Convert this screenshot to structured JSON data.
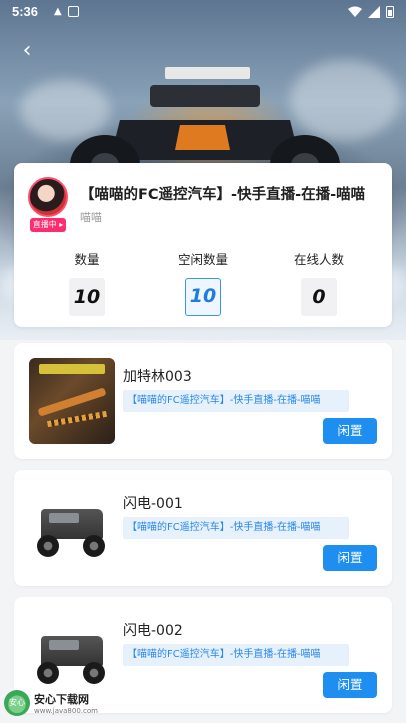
{
  "status_bar": {
    "time": "5:36"
  },
  "live_room": {
    "title": "【喵喵的FC遥控汽车】-快手直播-在播-喵喵",
    "host": "喵喵",
    "live_badge": "直播中 ▸"
  },
  "stats": [
    {
      "label": "数量",
      "value": "10",
      "active": false
    },
    {
      "label": "空闲数量",
      "value": "10",
      "active": true
    },
    {
      "label": "在线人数",
      "value": "0",
      "active": false
    }
  ],
  "devices": [
    {
      "name": "加特林003",
      "room": "【喵喵的FC遥控汽车】-快手直播-在播-喵喵",
      "status": "闲置",
      "thumb": "gatling"
    },
    {
      "name": "闪电-001",
      "room": "【喵喵的FC遥控汽车】-快手直播-在播-喵喵",
      "status": "闲置",
      "thumb": "truck"
    },
    {
      "name": "闪电-002",
      "room": "【喵喵的FC遥控汽车】-快手直播-在播-喵喵",
      "status": "闲置",
      "thumb": "truck"
    }
  ],
  "watermark": {
    "brand": "安心下载网",
    "url": "www.java800.com",
    "logo_text": "安心"
  },
  "colors": {
    "primary": "#1e8ef0",
    "live_badge": "#ff2d6f",
    "room_tag_bg": "#e6f1fc"
  }
}
